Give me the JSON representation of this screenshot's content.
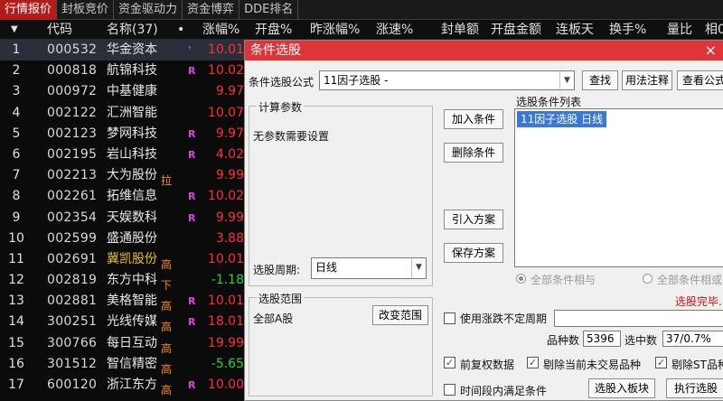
{
  "tabs": [
    "行情报价",
    "封板竞价",
    "资金驱动力",
    "资金博弈",
    "DDE排名"
  ],
  "columns": {
    "arrow": "▼",
    "code": "代码",
    "name": "名称(37)",
    "dot": "•",
    "change": "涨幅%",
    "open": "开盘%",
    "prev_change": "昨涨幅%",
    "speed": "涨速%",
    "seal": "封单额",
    "open_amount": "开盘金额",
    "limit_days": "连板天",
    "turnover": "换手%",
    "ratio": "量比",
    "more": "相0"
  },
  "rows": [
    {
      "idx": "1",
      "code": "000532",
      "name": "华金资本",
      "mark": "'",
      "tag": "",
      "pct": "10.01",
      "dir": "up",
      "hl": false
    },
    {
      "idx": "2",
      "code": "000818",
      "name": "航锦科技",
      "mark": "R",
      "tag": "",
      "pct": "10.02",
      "dir": "up",
      "hl": false
    },
    {
      "idx": "3",
      "code": "000972",
      "name": "中基健康",
      "mark": "",
      "tag": "",
      "pct": "9.97",
      "dir": "up",
      "hl": false
    },
    {
      "idx": "4",
      "code": "002122",
      "name": "汇洲智能",
      "mark": "",
      "tag": "",
      "pct": "10.07",
      "dir": "up",
      "hl": false
    },
    {
      "idx": "5",
      "code": "002123",
      "name": "梦网科技",
      "mark": "R",
      "tag": "",
      "pct": "9.97",
      "dir": "up",
      "hl": false
    },
    {
      "idx": "6",
      "code": "002195",
      "name": "岩山科技",
      "mark": "R",
      "tag": "",
      "pct": "4.02",
      "dir": "up",
      "hl": false
    },
    {
      "idx": "7",
      "code": "002213",
      "name": "大为股份",
      "mark": "",
      "tag": "拉",
      "pct": "9.99",
      "dir": "up",
      "hl": false
    },
    {
      "idx": "8",
      "code": "002261",
      "name": "拓维信息",
      "mark": "R",
      "tag": "",
      "pct": "10.02",
      "dir": "up",
      "hl": false
    },
    {
      "idx": "9",
      "code": "002354",
      "name": "天娱数科",
      "mark": "R",
      "tag": "",
      "pct": "9.99",
      "dir": "up",
      "hl": false
    },
    {
      "idx": "10",
      "code": "002599",
      "name": "盛通股份",
      "mark": "",
      "tag": "",
      "pct": "3.88",
      "dir": "up",
      "hl": false
    },
    {
      "idx": "11",
      "code": "002691",
      "name": "冀凯股份",
      "mark": "",
      "tag": "高",
      "pct": "10.01",
      "dir": "up",
      "hl": true
    },
    {
      "idx": "12",
      "code": "002819",
      "name": "东方中科",
      "mark": "",
      "tag": "下",
      "pct": "-1.18",
      "dir": "down",
      "hl": false
    },
    {
      "idx": "13",
      "code": "002881",
      "name": "美格智能",
      "mark": "R",
      "tag": "高",
      "pct": "10.01",
      "dir": "up",
      "hl": false
    },
    {
      "idx": "14",
      "code": "300251",
      "name": "光线传媒",
      "mark": "R",
      "tag": "高",
      "pct": "18.01",
      "dir": "up",
      "hl": false
    },
    {
      "idx": "15",
      "code": "300766",
      "name": "每日互动",
      "mark": "",
      "tag": "高",
      "pct": "19.99",
      "dir": "up",
      "hl": false
    },
    {
      "idx": "16",
      "code": "301512",
      "name": "智信精密",
      "mark": "",
      "tag": "高",
      "pct": "-5.65",
      "dir": "down",
      "hl": false
    },
    {
      "idx": "17",
      "code": "600120",
      "name": "浙江东方",
      "mark": "R",
      "tag": "高",
      "pct": "10.00",
      "dir": "up",
      "hl": false
    }
  ],
  "dialog": {
    "title": "条件选股",
    "close": "×",
    "formula_label": "条件选股公式",
    "formula_value": "11因子选股  -",
    "find_btn": "查找",
    "usage_btn": "用法注释",
    "view_btn": "查看公式",
    "params_group": "计算参数",
    "params_text": "无参数需要设置",
    "add_btn": "加入条件",
    "del_btn": "删除条件",
    "import_btn": "引入方案",
    "save_btn": "保存方案",
    "list_label": "选股条件列表",
    "list_item": "11因子选股  日线",
    "period_label": "选股周期:",
    "period_value": "日线",
    "radio_and": "全部条件相与",
    "radio_or": "全部条件相或",
    "done_text": "选股完毕.",
    "range_group": "选股范围",
    "range_value": "全部A股",
    "range_btn": "改变范围",
    "uncertain_label": "使用涨跌不定周期",
    "count_label": "品种数",
    "count_value": "5396",
    "hit_label": "选中数",
    "hit_value": "37/0.7%",
    "chk_prefq": "前复权数据",
    "chk_exclude_notrade": "剔除当前未交易品种",
    "chk_exclude_st": "剔除ST品种",
    "chk_period": "时间段内满足条件",
    "to_block_btn": "选股入板块",
    "run_btn": "执行选股"
  }
}
